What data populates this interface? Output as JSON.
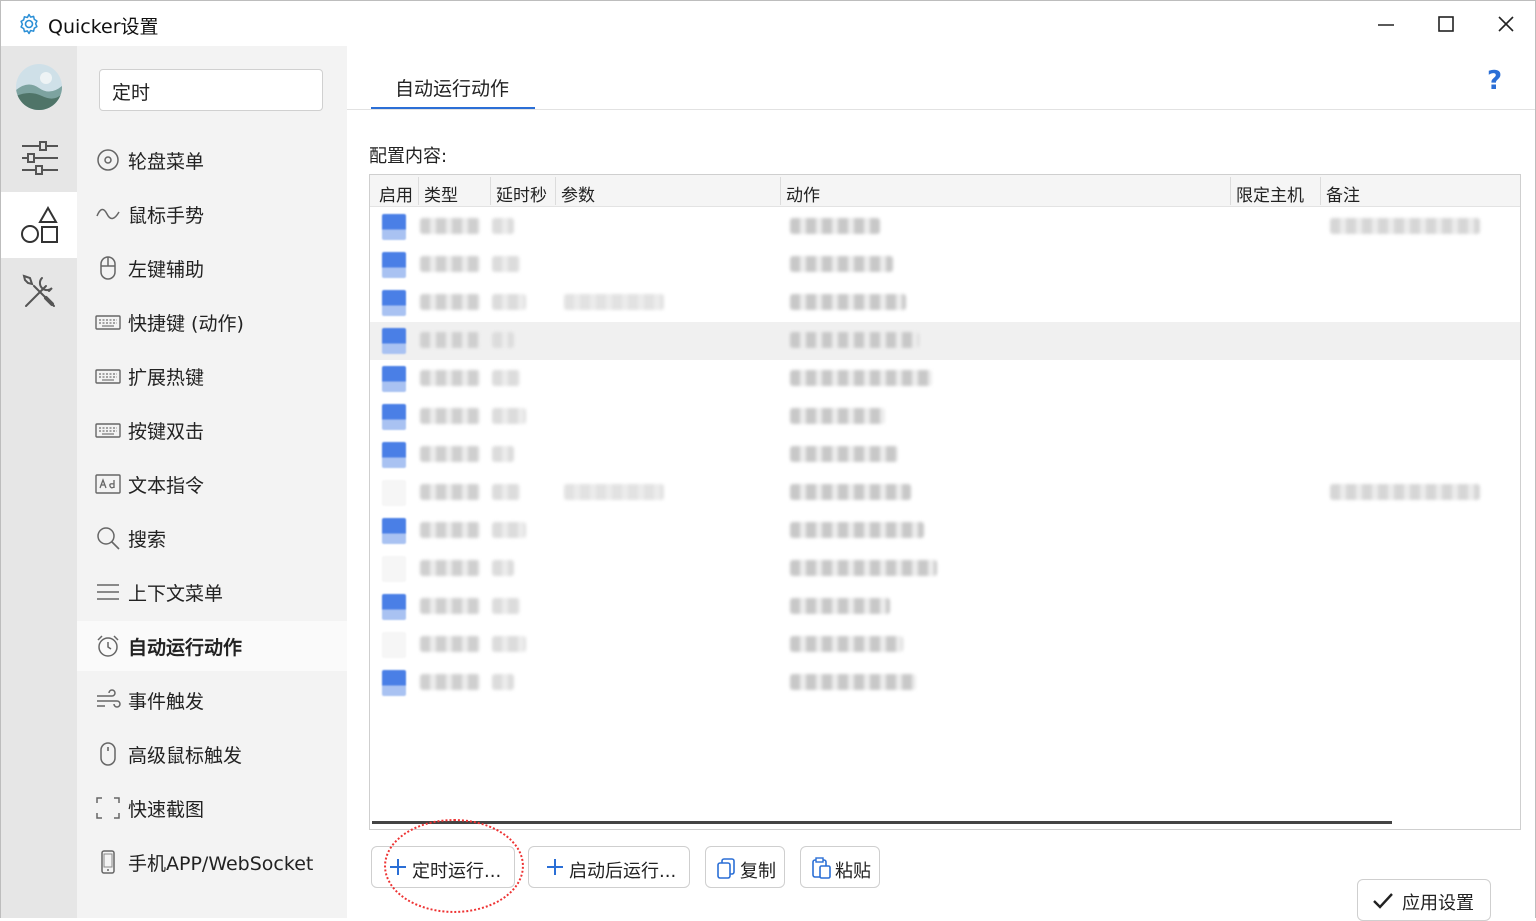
{
  "window": {
    "title": "Quicker设置",
    "controls": [
      "minimize",
      "maximize",
      "close"
    ]
  },
  "rail": {
    "items": [
      {
        "name": "settings",
        "icon": "sliders-icon"
      },
      {
        "name": "actions",
        "icon": "shapes-icon",
        "active": true
      },
      {
        "name": "tools",
        "icon": "tools-icon"
      }
    ]
  },
  "nav": {
    "search_value": "定时",
    "items": [
      {
        "label": "轮盘菜单",
        "icon": "circle-dot-icon"
      },
      {
        "label": "鼠标手势",
        "icon": "wave-icon"
      },
      {
        "label": "左键辅助",
        "icon": "mouse-icon"
      },
      {
        "label": "快捷键 (动作)",
        "icon": "keyboard-icon"
      },
      {
        "label": "扩展热键",
        "icon": "keyboard-icon"
      },
      {
        "label": "按键双击",
        "icon": "keyboard-icon"
      },
      {
        "label": "文本指令",
        "icon": "ad-text-icon"
      },
      {
        "label": "搜索",
        "icon": "search-icon"
      },
      {
        "label": "上下文菜单",
        "icon": "menu-icon"
      },
      {
        "label": "自动运行动作",
        "icon": "alarm-clock-icon",
        "active": true
      },
      {
        "label": "事件触发",
        "icon": "wind-icon"
      },
      {
        "label": "高级鼠标触发",
        "icon": "mouse-icon"
      },
      {
        "label": "快速截图",
        "icon": "screenshot-icon"
      },
      {
        "label": "手机APP/WebSocket",
        "icon": "phone-icon"
      }
    ]
  },
  "main": {
    "tab_label": "自动运行动作",
    "help_label": "?",
    "config_label": "配置内容:",
    "columns": [
      "启用",
      "类型",
      "延时秒",
      "参数",
      "动作",
      "限定主机",
      "备注"
    ],
    "rows": [
      {
        "enabled": true,
        "has_param": false,
        "has_note": true
      },
      {
        "enabled": true,
        "has_param": false,
        "has_note": false
      },
      {
        "enabled": true,
        "has_param": true,
        "has_note": false
      },
      {
        "enabled": true,
        "has_param": false,
        "has_note": false,
        "selected": true
      },
      {
        "enabled": true,
        "has_param": false,
        "has_note": false
      },
      {
        "enabled": true,
        "has_param": false,
        "has_note": false
      },
      {
        "enabled": true,
        "has_param": false,
        "has_note": false
      },
      {
        "enabled": false,
        "has_param": true,
        "has_note": true
      },
      {
        "enabled": true,
        "has_param": false,
        "has_note": false
      },
      {
        "enabled": false,
        "has_param": false,
        "has_note": false
      },
      {
        "enabled": true,
        "has_param": false,
        "has_note": false
      },
      {
        "enabled": false,
        "has_param": false,
        "has_note": false
      },
      {
        "enabled": true,
        "has_param": false,
        "has_note": false
      }
    ],
    "buttons": {
      "schedule": "定时运行...",
      "after_start": "启动后运行...",
      "copy": "复制",
      "paste": "粘贴",
      "apply": "应用设置"
    }
  },
  "colors": {
    "accent": "#2b6fd6",
    "checkbox_on": "#4a7fe6",
    "annotation": "#e33333"
  }
}
